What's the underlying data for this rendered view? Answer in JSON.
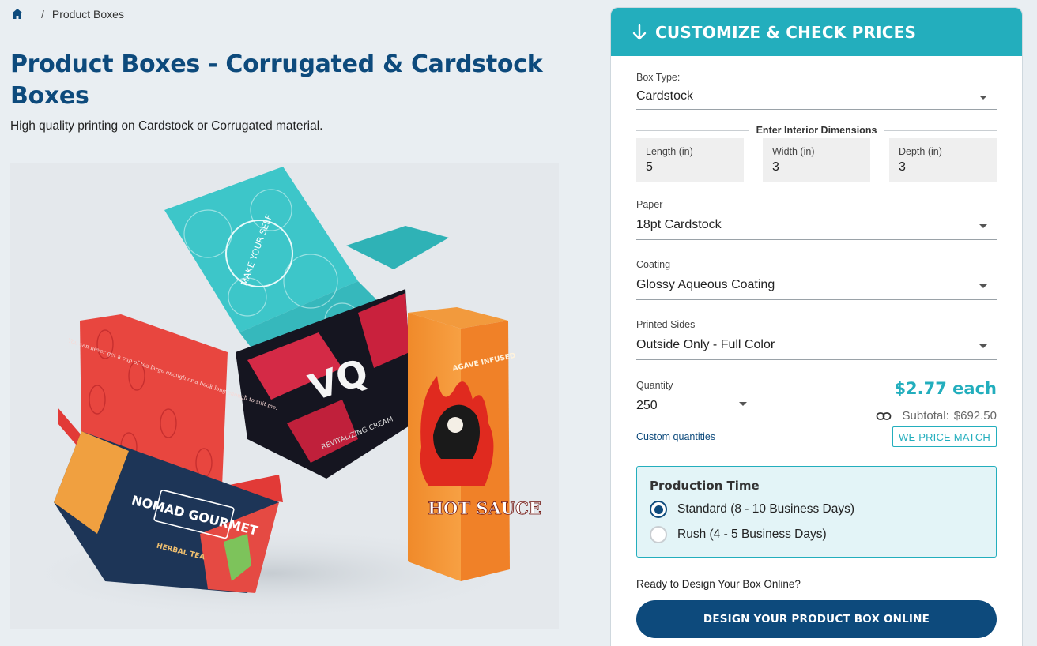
{
  "breadcrumb": {
    "current": "Product Boxes",
    "separator": "/"
  },
  "page": {
    "title": "Product Boxes - Corrugated & Cardstock Boxes",
    "subtitle": "High quality printing on Cardstock or Corrugated material."
  },
  "hero_image": {
    "cardstock_box_text": "MAKE YOUR SELF",
    "tea_box_quote": "You can never get a cup of tea large enough or a book long enough to suit me.",
    "tea_box_brand": "NOMAD GOURMET",
    "tea_box_product": "HERBAL TEA",
    "black_box_logo": "VQ",
    "black_box_text": "REVITALIZING CREAM",
    "hot_sauce_top": "AGAVE INFUSED",
    "hot_sauce_label": "HOT SAUCE"
  },
  "panel": {
    "header": "CUSTOMIZE & CHECK PRICES",
    "box_type": {
      "label": "Box Type:",
      "value": "Cardstock"
    },
    "dimensions_title": "Enter Interior Dimensions",
    "dimensions": [
      {
        "label": "Length (in)",
        "value": "5"
      },
      {
        "label": "Width (in)",
        "value": "3"
      },
      {
        "label": "Depth (in)",
        "value": "3"
      }
    ],
    "paper": {
      "label": "Paper",
      "value": "18pt Cardstock"
    },
    "coating": {
      "label": "Coating",
      "value": "Glossy Aqueous Coating"
    },
    "printed_sides": {
      "label": "Printed Sides",
      "value": "Outside Only - Full Color"
    },
    "quantity": {
      "label": "Quantity",
      "value": "250"
    },
    "price_each": "$2.77 each",
    "subtotal_label": "Subtotal:",
    "subtotal_value": "$692.50",
    "custom_quantities": "Custom quantities",
    "price_match": "WE PRICE MATCH",
    "production": {
      "title": "Production Time",
      "options": [
        {
          "label": "Standard (8 - 10 Business Days)",
          "selected": true
        },
        {
          "label": "Rush (4 - 5 Business Days)",
          "selected": false
        }
      ]
    },
    "ready_text": "Ready to Design Your Box Online?",
    "design_button": "DESIGN YOUR PRODUCT BOX ONLINE"
  },
  "colors": {
    "brand_navy": "#0d4a7c",
    "accent_teal": "#23aebd",
    "page_bg": "#e9eef2"
  }
}
